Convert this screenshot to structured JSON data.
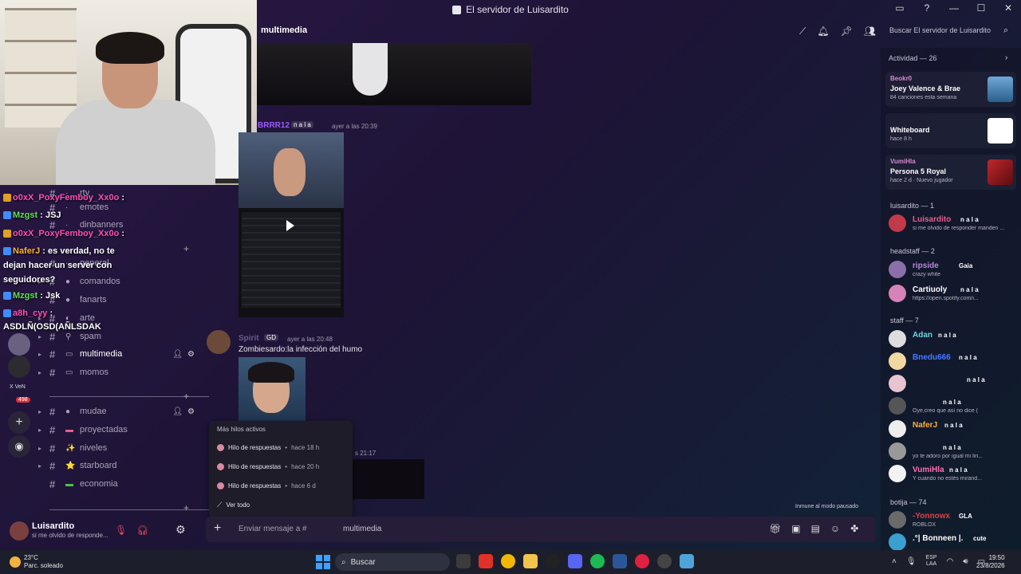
{
  "window": {
    "title": "El servidor de Luisardito"
  },
  "header": {
    "channel": "multimedia",
    "search_placeholder": "Buscar El servidor de Luisardito"
  },
  "chat_overlay": [
    {
      "name": "o0xX_PoxyFemboy_Xx0o",
      "text": ":"
    },
    {
      "name": "Mzgst",
      "text": ": JSJ"
    },
    {
      "name": "o0xX_PoxyFemboy_Xx0o",
      "text": ":"
    },
    {
      "name": "NaferJ",
      "text": ": es verdad, no te dejan hacer un server con seguidores?"
    },
    {
      "name": "Mzgst",
      "text": ": Jsk"
    },
    {
      "name": "a8h_cyy",
      "text": ":"
    },
    {
      "name": "",
      "text": "ASDLÑ(OSD(AÑLSDAK"
    }
  ],
  "chat_overlay_lines": {
    "l4a": "es verdad, no te",
    "l4b": "dejan hacer un server con",
    "l4c": "seguidores?"
  },
  "channels": [
    {
      "name": "rtv",
      "icon": ""
    },
    {
      "name": "emotes",
      "icon": ""
    },
    {
      "name": "dinbanners",
      "icon": ""
    },
    {
      "name": "general",
      "icon": ""
    },
    {
      "name": "comandos",
      "icon": ""
    },
    {
      "name": "fanarts",
      "icon": ""
    },
    {
      "name": "arte",
      "icon": ""
    },
    {
      "name": "spam",
      "icon": ""
    },
    {
      "name": "multimedia",
      "icon": ""
    },
    {
      "name": "momos",
      "icon": ""
    },
    {
      "name": "mudae",
      "icon": ""
    },
    {
      "name": "proyectadas",
      "icon": ""
    },
    {
      "name": "niveles",
      "icon": "✨"
    },
    {
      "name": "starboard",
      "icon": "⭐"
    },
    {
      "name": "economia",
      "icon": ""
    }
  ],
  "server_badge": "498",
  "server_label": "X VeN",
  "user": {
    "name": "Luisardito",
    "status": "si me olvido de responde..."
  },
  "messages": [
    {
      "author": "BRRR12",
      "role": "n a l a",
      "time": "ayer a las 20:39"
    },
    {
      "author": "Spirit",
      "role": "GD",
      "time": "ayer a las 20:48",
      "text": "Zombiesardo:la infección del humo"
    },
    {
      "author": "",
      "role": "",
      "time": "s 21:17"
    }
  ],
  "threads": {
    "title": "Más hilos activos",
    "items": [
      {
        "label": "Hilo de respuestas",
        "time": "hace 18 h"
      },
      {
        "label": "Hilo de respuestas",
        "time": "hace 20 h"
      },
      {
        "label": "Hilo de respuestas",
        "time": "hace 6 d"
      }
    ],
    "see_all": "Ver todo"
  },
  "immune": "Inmune al modo pausado",
  "composer": {
    "placeholder": "Enviar mensaje a #",
    "channel": "multimedia"
  },
  "activity": {
    "header": "Actividad — 26",
    "cards": [
      {
        "top": "Beokr0",
        "title": "Joey Valence & Brae",
        "sub": "84 canciones esta semana"
      },
      {
        "top": "",
        "title": "Whiteboard",
        "sub": "hace 8 h"
      },
      {
        "top": "VumiHla",
        "title": "Persona 5 Royal",
        "sub": "hace 2 d · Nuevo jugador"
      }
    ]
  },
  "groups": [
    {
      "header": "luisardito — 1",
      "members": [
        {
          "name": "Luisardito",
          "tag": "n a l a",
          "status": "si me olvido de responder manden ..."
        }
      ]
    },
    {
      "header": "headstaff — 2",
      "members": [
        {
          "name": "ripside",
          "tag": "Gaia",
          "status": "crazy white"
        },
        {
          "name": "Cartiuoly",
          "tag": "n a l a",
          "status": "https://open.spotify.com/i..."
        }
      ]
    },
    {
      "header": "staff — 7",
      "members": [
        {
          "name": "Adan",
          "tag": "n a l a",
          "status": ""
        },
        {
          "name": "Bnedu666",
          "tag": "n a l a",
          "status": ""
        },
        {
          "name": "",
          "tag": "n a l a",
          "status": ""
        },
        {
          "name": "",
          "tag": "n a l a",
          "status": "Oye,creo que así no dice ("
        },
        {
          "name": "NaferJ",
          "tag": "n a l a",
          "status": ""
        },
        {
          "name": "",
          "tag": "n a l a",
          "status": "yo te adoro por igual mi lin..."
        },
        {
          "name": "VumiHla",
          "tag": "n a l a",
          "status": "Y cuando no estés mirand..."
        }
      ]
    },
    {
      "header": "botija — 74",
      "members": [
        {
          "name": "-Yonnowx",
          "tag": "GLA",
          "status": "ROBLOX"
        },
        {
          "name": ".°| Bonneen |.",
          "tag": "cute",
          "status": ""
        }
      ]
    }
  ],
  "taskbar": {
    "weather_temp": "23°C",
    "weather_desc": "Parc. soleado",
    "search": "Buscar",
    "lang1": "ESP",
    "lang2": "LAA",
    "time": "19:50",
    "date": "23/8/2026"
  },
  "colors": {
    "accent_pink": "#ff4fb8",
    "accent_green": "#5be34f",
    "accent_orange": "#ffb037",
    "purple_name": "#9b59ff",
    "blue_name": "#4a7bff"
  }
}
